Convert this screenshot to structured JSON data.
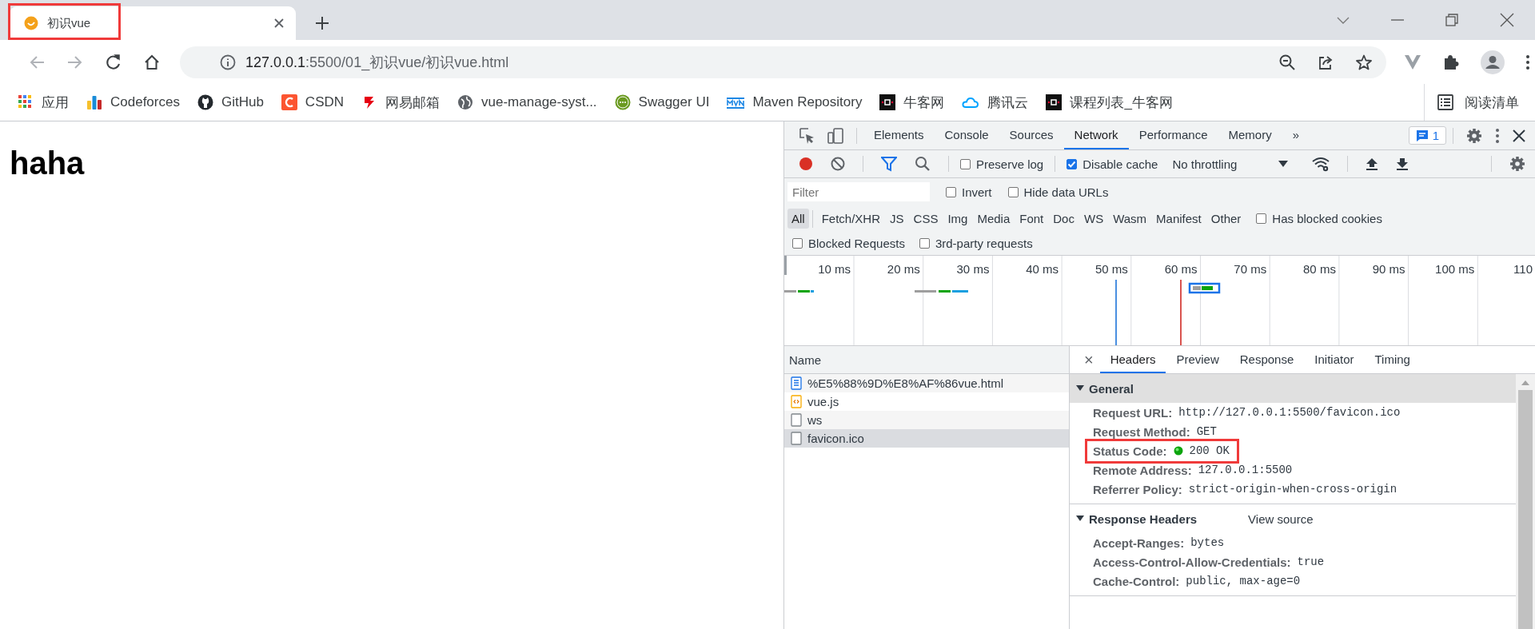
{
  "browser": {
    "tab": {
      "title": "初识vue",
      "annotated": true
    },
    "address": {
      "host": "127.0.0.1",
      "path": ":5500/01_初识vue/初识vue.html"
    },
    "bookmarks": [
      {
        "kind": "apps",
        "label": "应用"
      },
      {
        "kind": "chart",
        "label": "Codeforces"
      },
      {
        "kind": "github",
        "label": "GitHub"
      },
      {
        "kind": "csdn",
        "label": "CSDN"
      },
      {
        "kind": "mail",
        "label": "网易邮箱"
      },
      {
        "kind": "globe",
        "label": "vue-manage-syst..."
      },
      {
        "kind": "swagger",
        "label": "Swagger UI"
      },
      {
        "kind": "maven",
        "label": "Maven Repository"
      },
      {
        "kind": "nowcoder",
        "label": "牛客网"
      },
      {
        "kind": "cloud",
        "label": "腾讯云"
      },
      {
        "kind": "nowcoder",
        "label": "课程列表_牛客网"
      }
    ],
    "reading_list": "阅读清单"
  },
  "page": {
    "heading": "haha"
  },
  "devtools": {
    "tabs": [
      {
        "label": "Elements",
        "selected": false
      },
      {
        "label": "Console",
        "selected": false
      },
      {
        "label": "Sources",
        "selected": false
      },
      {
        "label": "Network",
        "selected": true
      },
      {
        "label": "Performance",
        "selected": false
      },
      {
        "label": "Memory",
        "selected": false
      }
    ],
    "more_tabs": "»",
    "issues_count": "1",
    "toolbar": {
      "recording": true,
      "checkboxes": [
        {
          "label": "Preserve log",
          "checked": false
        },
        {
          "label": "Disable cache",
          "checked": true
        }
      ],
      "throttling": "No throttling"
    },
    "filter": {
      "placeholder": "Filter",
      "options": [
        {
          "label": "Invert",
          "checked": false
        },
        {
          "label": "Hide data URLs",
          "checked": false
        }
      ]
    },
    "types": [
      {
        "label": "All",
        "selected": true
      },
      {
        "label": "Fetch/XHR",
        "selected": false
      },
      {
        "label": "JS",
        "selected": false
      },
      {
        "label": "CSS",
        "selected": false
      },
      {
        "label": "Img",
        "selected": false
      },
      {
        "label": "Media",
        "selected": false
      },
      {
        "label": "Font",
        "selected": false
      },
      {
        "label": "Doc",
        "selected": false
      },
      {
        "label": "WS",
        "selected": false
      },
      {
        "label": "Wasm",
        "selected": false
      },
      {
        "label": "Manifest",
        "selected": false
      },
      {
        "label": "Other",
        "selected": false
      }
    ],
    "type_options": [
      {
        "label": "Has blocked cookies",
        "checked": false
      }
    ],
    "extra_options": [
      {
        "label": "Blocked Requests",
        "checked": false
      },
      {
        "label": "3rd-party requests",
        "checked": false
      }
    ],
    "timeline": {
      "ticks": [
        "10 ms",
        "20 ms",
        "30 ms",
        "40 ms",
        "50 ms",
        "60 ms",
        "70 ms",
        "80 ms",
        "90 ms",
        "100 ms",
        "110"
      ]
    },
    "requests": {
      "column": "Name",
      "rows": [
        {
          "name": "%E5%88%9D%E8%AF%86vue.html",
          "kind": "document",
          "selected": false
        },
        {
          "name": "vue.js",
          "kind": "script",
          "selected": false
        },
        {
          "name": "ws",
          "kind": "other",
          "selected": false
        },
        {
          "name": "favicon.ico",
          "kind": "other",
          "selected": true
        }
      ]
    },
    "details": {
      "close": "×",
      "tabs": [
        {
          "label": "Headers",
          "selected": true
        },
        {
          "label": "Preview",
          "selected": false
        },
        {
          "label": "Response",
          "selected": false
        },
        {
          "label": "Initiator",
          "selected": false
        },
        {
          "label": "Timing",
          "selected": false
        }
      ],
      "sections": [
        {
          "title": "General",
          "expanded": true,
          "rows": [
            {
              "key": "Request URL:",
              "value": "http://127.0.0.1:5500/favicon.ico",
              "kind": "plain",
              "annotated": false
            },
            {
              "key": "Request Method:",
              "value": "GET",
              "kind": "plain",
              "annotated": false
            },
            {
              "key": "Status Code:",
              "value": "200 OK",
              "kind": "status",
              "annotated": true
            },
            {
              "key": "Remote Address:",
              "value": "127.0.0.1:5500",
              "kind": "plain",
              "annotated": false
            },
            {
              "key": "Referrer Policy:",
              "value": "strict-origin-when-cross-origin",
              "kind": "plain",
              "annotated": false
            }
          ]
        },
        {
          "title": "Response Headers",
          "expanded": true,
          "link": "View source",
          "rows": [
            {
              "key": "Accept-Ranges:",
              "value": "bytes",
              "kind": "plain",
              "annotated": false
            },
            {
              "key": "Access-Control-Allow-Credentials:",
              "value": "true",
              "kind": "plain",
              "annotated": false
            },
            {
              "key": "Cache-Control:",
              "value": "public, max-age=0",
              "kind": "plain",
              "annotated": false
            }
          ]
        }
      ]
    }
  }
}
